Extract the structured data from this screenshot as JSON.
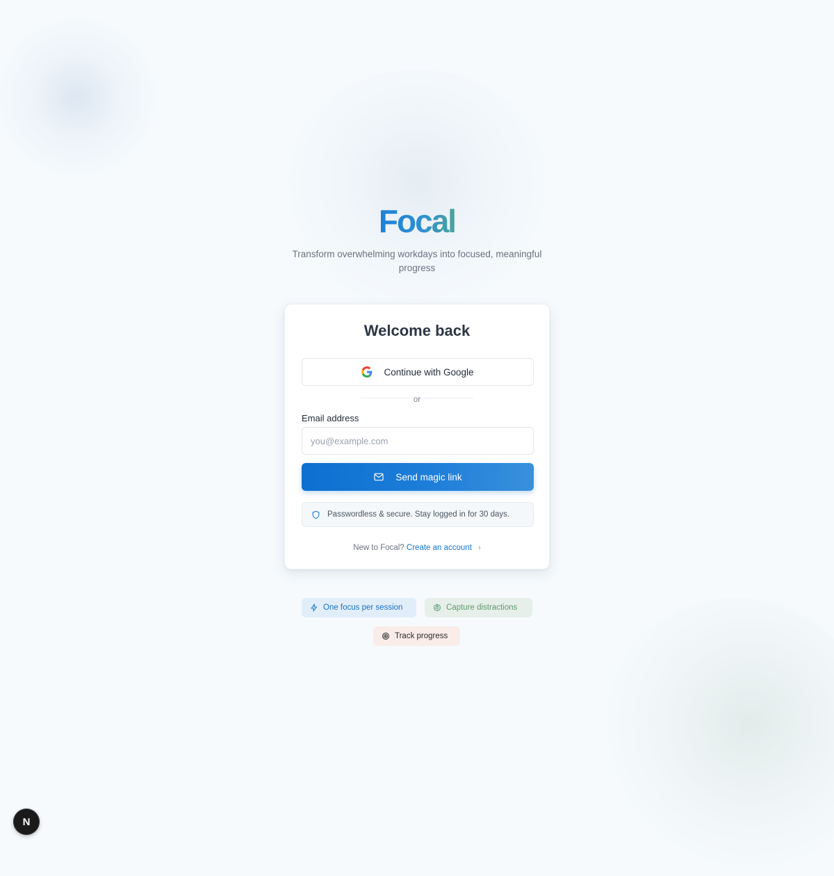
{
  "brand": {
    "name": "Focal",
    "tagline": "Transform overwhelming workdays into focused, meaningful progress",
    "gradient_start": "#1e7fd6",
    "gradient_end": "#4aa39a"
  },
  "card": {
    "title": "Welcome back",
    "google_button_label": "Continue with Google",
    "divider_text": "or",
    "email_label": "Email address",
    "email_value": "",
    "email_placeholder": "you@example.com",
    "magic_link_label": "Send magic link",
    "secure_note": "Passwordless & secure. Stay logged in for 30 days.",
    "signup_prompt": "New to Focal?",
    "signup_link": "Create an account",
    "accent_color": "#1477cc"
  },
  "features": [
    {
      "label": "One focus per session",
      "icon": "lightning-icon",
      "color": "#1670c4"
    },
    {
      "label": "Capture distractions",
      "icon": "brain-icon",
      "color": "#5e9a6c"
    },
    {
      "label": "Track progress",
      "icon": "target-icon",
      "color": "#2b2b2b"
    }
  ],
  "dev_badge": {
    "letter": "N",
    "icon": "nextjs-icon"
  }
}
